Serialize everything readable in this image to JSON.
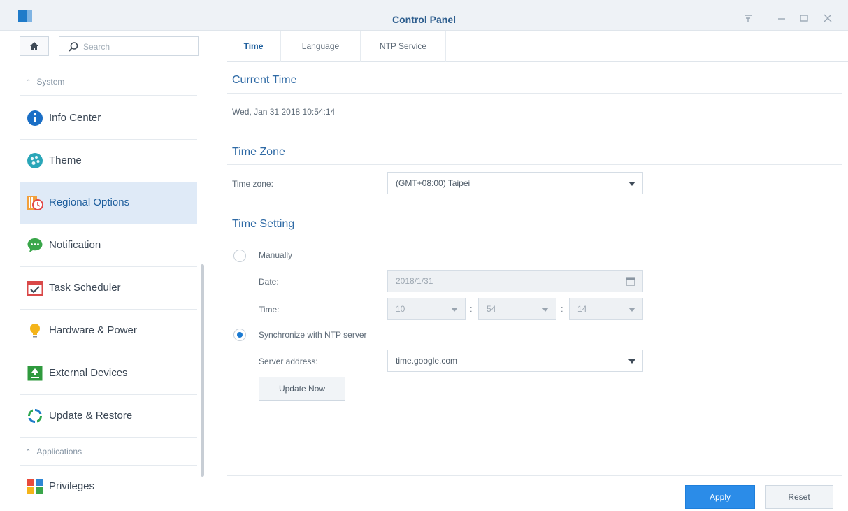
{
  "window": {
    "title": "Control Panel",
    "controls": [
      "pin-icon",
      "minimize-icon",
      "maximize-icon",
      "close-icon"
    ]
  },
  "sidebar": {
    "search_placeholder": "Search",
    "sections": {
      "system": "System",
      "applications": "Applications"
    },
    "items": [
      {
        "label": "Info Center",
        "icon": "info-icon"
      },
      {
        "label": "Theme",
        "icon": "theme-icon"
      },
      {
        "label": "Regional Options",
        "icon": "regional-options-icon",
        "active": true
      },
      {
        "label": "Notification",
        "icon": "notification-icon"
      },
      {
        "label": "Task Scheduler",
        "icon": "task-scheduler-icon"
      },
      {
        "label": "Hardware & Power",
        "icon": "hardware-power-icon"
      },
      {
        "label": "External Devices",
        "icon": "external-devices-icon"
      },
      {
        "label": "Update & Restore",
        "icon": "update-restore-icon"
      },
      {
        "label": "Privileges",
        "icon": "privileges-icon"
      }
    ]
  },
  "tabs": [
    {
      "label": "Time",
      "active": true
    },
    {
      "label": "Language"
    },
    {
      "label": "NTP Service"
    }
  ],
  "current_time": {
    "title": "Current Time",
    "value": "Wed, Jan 31 2018 10:54:14"
  },
  "time_zone": {
    "title": "Time Zone",
    "label": "Time zone:",
    "value": "(GMT+08:00) Taipei"
  },
  "time_setting": {
    "title": "Time Setting",
    "manual_label": "Manually",
    "date_label": "Date:",
    "date_value": "2018/1/31",
    "time_label": "Time:",
    "hour": "10",
    "minute": "54",
    "second": "14",
    "ntp_label": "Synchronize with NTP server",
    "server_label": "Server address:",
    "server_value": "time.google.com",
    "update_button": "Update Now",
    "selected": "ntp"
  },
  "footer": {
    "apply": "Apply",
    "reset": "Reset"
  },
  "colors": {
    "accent": "#2b8ce8",
    "active_nav_bg": "#dfeaf7",
    "section_title": "#2f6aa5"
  }
}
